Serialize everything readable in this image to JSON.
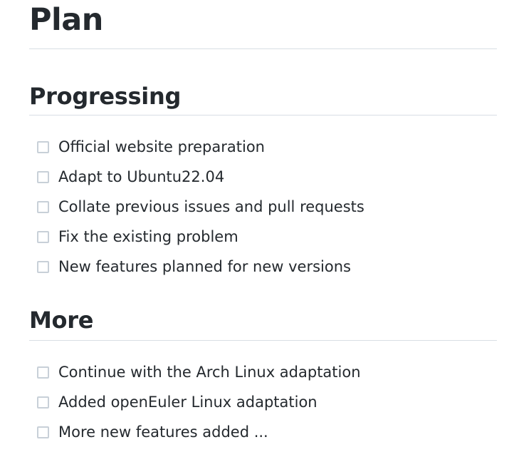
{
  "title": "Plan",
  "sections": [
    {
      "heading": "Progressing",
      "items": [
        "Official website preparation",
        "Adapt to Ubuntu22.04",
        "Collate previous issues and pull requests",
        "Fix the existing problem",
        "New features planned for new versions"
      ]
    },
    {
      "heading": "More",
      "items": [
        "Continue with the Arch Linux adaptation",
        "Added openEuler Linux adaptation",
        "More new features added ..."
      ]
    }
  ]
}
